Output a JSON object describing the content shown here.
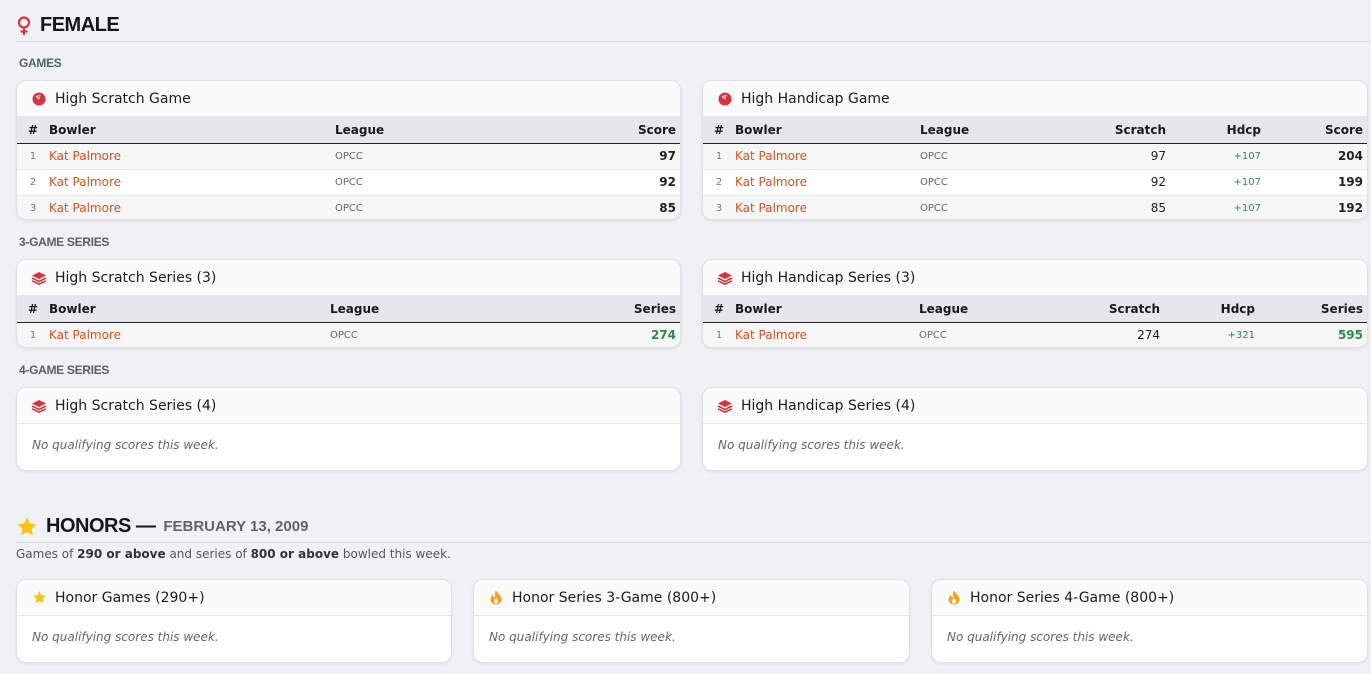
{
  "female": {
    "title": "FEMALE",
    "games_label": "GAMES",
    "series3_label": "3-GAME SERIES",
    "series4_label": "4-GAME SERIES",
    "columns": {
      "rank": "#",
      "bowler": "Bowler",
      "league": "League",
      "score": "Score",
      "scratch": "Scratch",
      "hdcp": "Hdcp",
      "series": "Series"
    },
    "high_scratch_game": {
      "title": "High Scratch Game",
      "rows": [
        {
          "rank": "1",
          "bowler": "Kat Palmore",
          "league": "OPCC",
          "score": "97"
        },
        {
          "rank": "2",
          "bowler": "Kat Palmore",
          "league": "OPCC",
          "score": "92"
        },
        {
          "rank": "3",
          "bowler": "Kat Palmore",
          "league": "OPCC",
          "score": "85"
        }
      ]
    },
    "high_handicap_game": {
      "title": "High Handicap Game",
      "rows": [
        {
          "rank": "1",
          "bowler": "Kat Palmore",
          "league": "OPCC",
          "scratch": "97",
          "hdcp": "+107",
          "score": "204"
        },
        {
          "rank": "2",
          "bowler": "Kat Palmore",
          "league": "OPCC",
          "scratch": "92",
          "hdcp": "+107",
          "score": "199"
        },
        {
          "rank": "3",
          "bowler": "Kat Palmore",
          "league": "OPCC",
          "scratch": "85",
          "hdcp": "+107",
          "score": "192"
        }
      ]
    },
    "high_scratch_series3": {
      "title": "High Scratch Series (3)",
      "rows": [
        {
          "rank": "1",
          "bowler": "Kat Palmore",
          "league": "OPCC",
          "series": "274"
        }
      ]
    },
    "high_handicap_series3": {
      "title": "High Handicap Series (3)",
      "rows": [
        {
          "rank": "1",
          "bowler": "Kat Palmore",
          "league": "OPCC",
          "scratch": "274",
          "hdcp": "+321",
          "series": "595"
        }
      ]
    },
    "high_scratch_series4": {
      "title": "High Scratch Series (4)",
      "empty": "No qualifying scores this week."
    },
    "high_handicap_series4": {
      "title": "High Handicap Series (4)",
      "empty": "No qualifying scores this week."
    }
  },
  "honors": {
    "title": "HONORS —",
    "date": "FEBRUARY 13, 2009",
    "desc_1": "Games of ",
    "desc_2": "290 or above",
    "desc_3": " and series of ",
    "desc_4": "800 or above",
    "desc_5": " bowled this week.",
    "games": {
      "title": "Honor Games (290+)",
      "empty": "No qualifying scores this week."
    },
    "series3": {
      "title": "Honor Series 3-Game (800+)",
      "empty": "No qualifying scores this week."
    },
    "series4": {
      "title": "Honor Series 4-Game (800+)",
      "empty": "No qualifying scores this week."
    }
  },
  "colors": {
    "accent_red": "#d6343f",
    "name_orange": "#d4531b",
    "green": "#2e8b4a",
    "star_yellow": "#f5c518"
  }
}
